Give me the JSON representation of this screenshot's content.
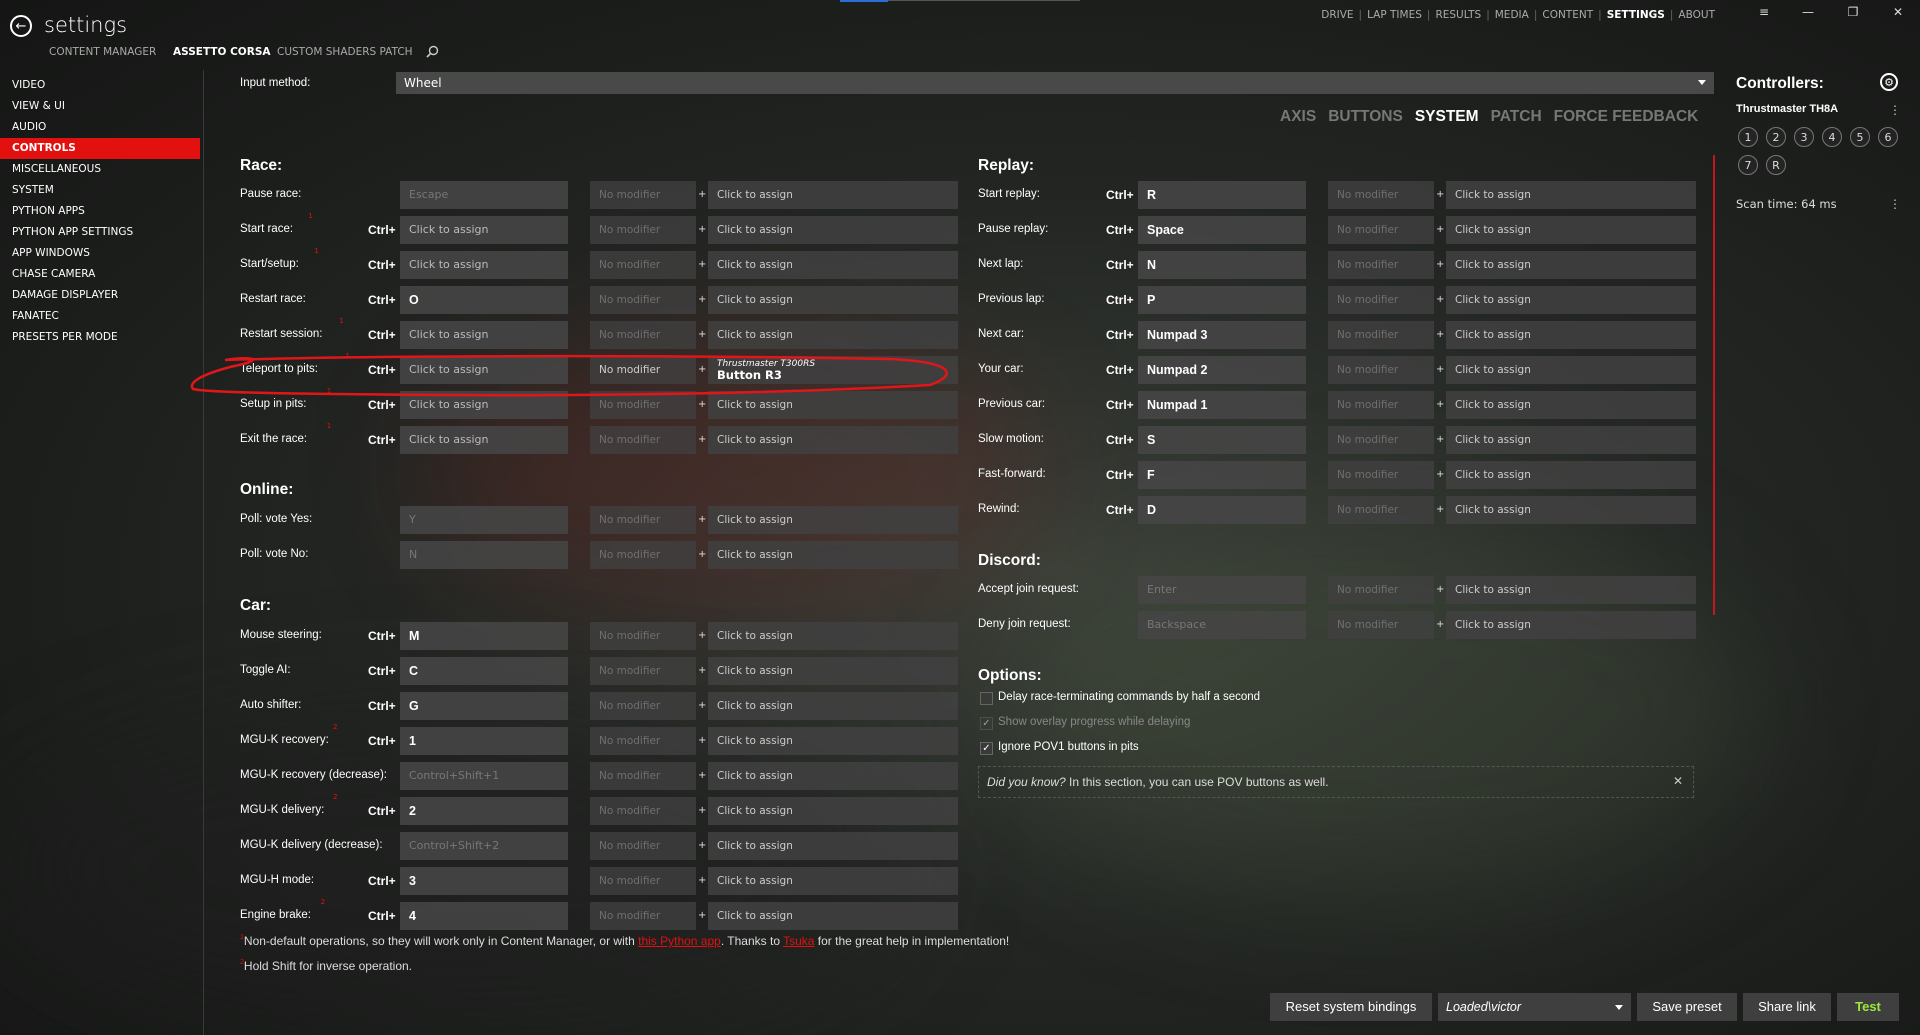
{
  "app": {
    "title": "settings",
    "back_icon": "back-arrow-icon"
  },
  "subtabs": [
    {
      "label": "CONTENT MANAGER",
      "active": false
    },
    {
      "label": "ASSETTO CORSA",
      "active": true
    },
    {
      "label": "CUSTOM SHADERS PATCH",
      "active": false
    }
  ],
  "topnav": [
    {
      "label": "DRIVE",
      "active": false
    },
    {
      "label": "LAP TIMES",
      "active": false
    },
    {
      "label": "RESULTS",
      "active": false
    },
    {
      "label": "MEDIA",
      "active": false
    },
    {
      "label": "CONTENT",
      "active": false
    },
    {
      "label": "SETTINGS",
      "active": true
    },
    {
      "label": "ABOUT",
      "active": false
    }
  ],
  "window": {
    "menu": "≡",
    "minimize": "—",
    "restore": "❐",
    "close": "✕"
  },
  "sidebar": [
    {
      "label": "VIDEO"
    },
    {
      "label": "VIEW & UI"
    },
    {
      "label": "AUDIO"
    },
    {
      "label": "CONTROLS",
      "active": true
    },
    {
      "label": "MISCELLANEOUS"
    },
    {
      "label": "SYSTEM"
    },
    {
      "label": "PYTHON APPS"
    },
    {
      "label": "PYTHON APP SETTINGS"
    },
    {
      "label": "APP WINDOWS"
    },
    {
      "label": "CHASE CAMERA"
    },
    {
      "label": "DAMAGE DISPLAYER"
    },
    {
      "label": "FANATEC"
    },
    {
      "label": "PRESETS PER MODE"
    }
  ],
  "input_method": {
    "label": "Input method:",
    "value": "Wheel"
  },
  "tabs": [
    {
      "label": "AXIS",
      "active": false
    },
    {
      "label": "BUTTONS",
      "active": false
    },
    {
      "label": "SYSTEM",
      "active": true
    },
    {
      "label": "PATCH",
      "active": false
    },
    {
      "label": "FORCE FEEDBACK",
      "active": false
    }
  ],
  "common": {
    "ctrl": "Ctrl+",
    "plus": "+",
    "click_to_assign": "Click to assign",
    "no_modifier": "No modifier"
  },
  "race": {
    "title": "Race:",
    "rows": [
      {
        "label": "Pause race:",
        "ctrl": "",
        "key": "Escape",
        "key_state": "dim",
        "mod_on": false,
        "assign": "Click to assign"
      },
      {
        "label": "Start race:",
        "sup": "1",
        "ctrl": "Ctrl+",
        "key": "Click to assign",
        "key_state": "",
        "mod_on": false,
        "assign": "Click to assign"
      },
      {
        "label": "Start/setup:",
        "sup": "1",
        "ctrl": "Ctrl+",
        "key": "Click to assign",
        "key_state": "",
        "mod_on": false,
        "assign": "Click to assign"
      },
      {
        "label": "Restart race:",
        "ctrl": "Ctrl+",
        "key": "O",
        "key_state": "set",
        "mod_on": false,
        "assign": "Click to assign"
      },
      {
        "label": "Restart session:",
        "sup": "1",
        "ctrl": "Ctrl+",
        "key": "Click to assign",
        "key_state": "",
        "mod_on": false,
        "assign": "Click to assign"
      },
      {
        "label": "Teleport to pits:",
        "sup": "1",
        "ctrl": "Ctrl+",
        "key": "Click to assign",
        "key_state": "",
        "mod_on": true,
        "assign_device": "Thrustmaster T300RS",
        "assign_button": "Button R3"
      },
      {
        "label": "Setup in pits:",
        "sup": "1",
        "ctrl": "Ctrl+",
        "key": "Click to assign",
        "key_state": "",
        "mod_on": false,
        "assign": "Click to assign"
      },
      {
        "label": "Exit the race:",
        "sup": "1",
        "ctrl": "Ctrl+",
        "key": "Click to assign",
        "key_state": "",
        "mod_on": false,
        "assign": "Click to assign"
      }
    ]
  },
  "online": {
    "title": "Online:",
    "rows": [
      {
        "label": "Poll: vote Yes:",
        "ctrl": "",
        "key": "Y",
        "key_state": "dim",
        "assign": "Click to assign"
      },
      {
        "label": "Poll: vote No:",
        "ctrl": "",
        "key": "N",
        "key_state": "dim",
        "assign": "Click to assign"
      }
    ]
  },
  "car": {
    "title": "Car:",
    "rows": [
      {
        "label": "Mouse steering:",
        "ctrl": "Ctrl+",
        "key": "M",
        "key_state": "set",
        "assign": "Click to assign"
      },
      {
        "label": "Toggle AI:",
        "ctrl": "Ctrl+",
        "key": "C",
        "key_state": "set",
        "assign": "Click to assign"
      },
      {
        "label": "Auto shifter:",
        "ctrl": "Ctrl+",
        "key": "G",
        "key_state": "set",
        "assign": "Click to assign"
      },
      {
        "label": "MGU-K recovery:",
        "sup": "2",
        "ctrl": "Ctrl+",
        "key": "1",
        "key_state": "set",
        "assign": "Click to assign"
      },
      {
        "label": "MGU-K recovery (decrease):",
        "ctrl": "",
        "key": "Control+Shift+1",
        "key_state": "dim",
        "assign": "Click to assign"
      },
      {
        "label": "MGU-K delivery:",
        "sup": "2",
        "ctrl": "Ctrl+",
        "key": "2",
        "key_state": "set",
        "assign": "Click to assign"
      },
      {
        "label": "MGU-K delivery (decrease):",
        "ctrl": "",
        "key": "Control+Shift+2",
        "key_state": "dim",
        "assign": "Click to assign"
      },
      {
        "label": "MGU-H mode:",
        "ctrl": "Ctrl+",
        "key": "3",
        "key_state": "set",
        "assign": "Click to assign"
      },
      {
        "label": "Engine brake:",
        "sup": "2",
        "ctrl": "Ctrl+",
        "key": "4",
        "key_state": "set",
        "assign": "Click to assign"
      }
    ]
  },
  "replay": {
    "title": "Replay:",
    "rows": [
      {
        "label": "Start replay:",
        "ctrl": "Ctrl+",
        "key": "R",
        "key_state": "set",
        "assign": "Click to assign"
      },
      {
        "label": "Pause replay:",
        "ctrl": "Ctrl+",
        "key": "Space",
        "key_state": "set",
        "assign": "Click to assign"
      },
      {
        "label": "Next lap:",
        "ctrl": "Ctrl+",
        "key": "N",
        "key_state": "set",
        "assign": "Click to assign"
      },
      {
        "label": "Previous lap:",
        "ctrl": "Ctrl+",
        "key": "P",
        "key_state": "set",
        "assign": "Click to assign"
      },
      {
        "label": "Next car:",
        "ctrl": "Ctrl+",
        "key": "Numpad 3",
        "key_state": "set",
        "assign": "Click to assign"
      },
      {
        "label": "Your car:",
        "ctrl": "Ctrl+",
        "key": "Numpad 2",
        "key_state": "set",
        "assign": "Click to assign"
      },
      {
        "label": "Previous car:",
        "ctrl": "Ctrl+",
        "key": "Numpad 1",
        "key_state": "set",
        "assign": "Click to assign"
      },
      {
        "label": "Slow motion:",
        "ctrl": "Ctrl+",
        "key": "S",
        "key_state": "set",
        "assign": "Click to assign"
      },
      {
        "label": "Fast-forward:",
        "ctrl": "Ctrl+",
        "key": "F",
        "key_state": "set",
        "assign": "Click to assign"
      },
      {
        "label": "Rewind:",
        "ctrl": "Ctrl+",
        "key": "D",
        "key_state": "set",
        "assign": "Click to assign"
      }
    ]
  },
  "discord": {
    "title": "Discord:",
    "rows": [
      {
        "label": "Accept join request:",
        "ctrl": "",
        "key": "Enter",
        "key_state": "dim",
        "assign": "Click to assign"
      },
      {
        "label": "Deny join request:",
        "ctrl": "",
        "key": "Backspace",
        "key_state": "dim",
        "assign": "Click to assign"
      }
    ]
  },
  "options": {
    "title": "Options:",
    "items": [
      {
        "label": "Delay race-terminating commands by half a second",
        "checked": false,
        "enabled": true
      },
      {
        "label": "Show overlay progress while delaying",
        "checked": true,
        "enabled": false
      },
      {
        "label": "Ignore POV1 buttons in pits",
        "checked": true,
        "enabled": true
      }
    ],
    "tip_prefix": "Did you know?",
    "tip_text": " In this section, you can use POV buttons as well."
  },
  "footnotes": {
    "n1_sup": "1",
    "n1_a": "Non-default operations, so they will work only in Content Manager, or with ",
    "n1_link1": "this Python app",
    "n1_b": ". Thanks to ",
    "n1_link2": "Tsuka",
    "n1_c": " for the great help in implementation!",
    "n2_sup": "2",
    "n2": "Hold Shift for inverse operation."
  },
  "controllers": {
    "title": "Controllers:",
    "device": "Thrustmaster TH8A",
    "buttons": [
      "1",
      "2",
      "3",
      "4",
      "5",
      "6",
      "7",
      "R"
    ],
    "scan_time": "Scan time: 64 ms"
  },
  "bottom": {
    "reset": "Reset system bindings",
    "preset": "Loaded\\victor",
    "save": "Save preset",
    "share": "Share link",
    "test": "Test"
  },
  "colors": {
    "accent": "#e2110f",
    "test": "#9be83a",
    "tab_active": "#ffffff",
    "tab_inactive": "#777777"
  }
}
